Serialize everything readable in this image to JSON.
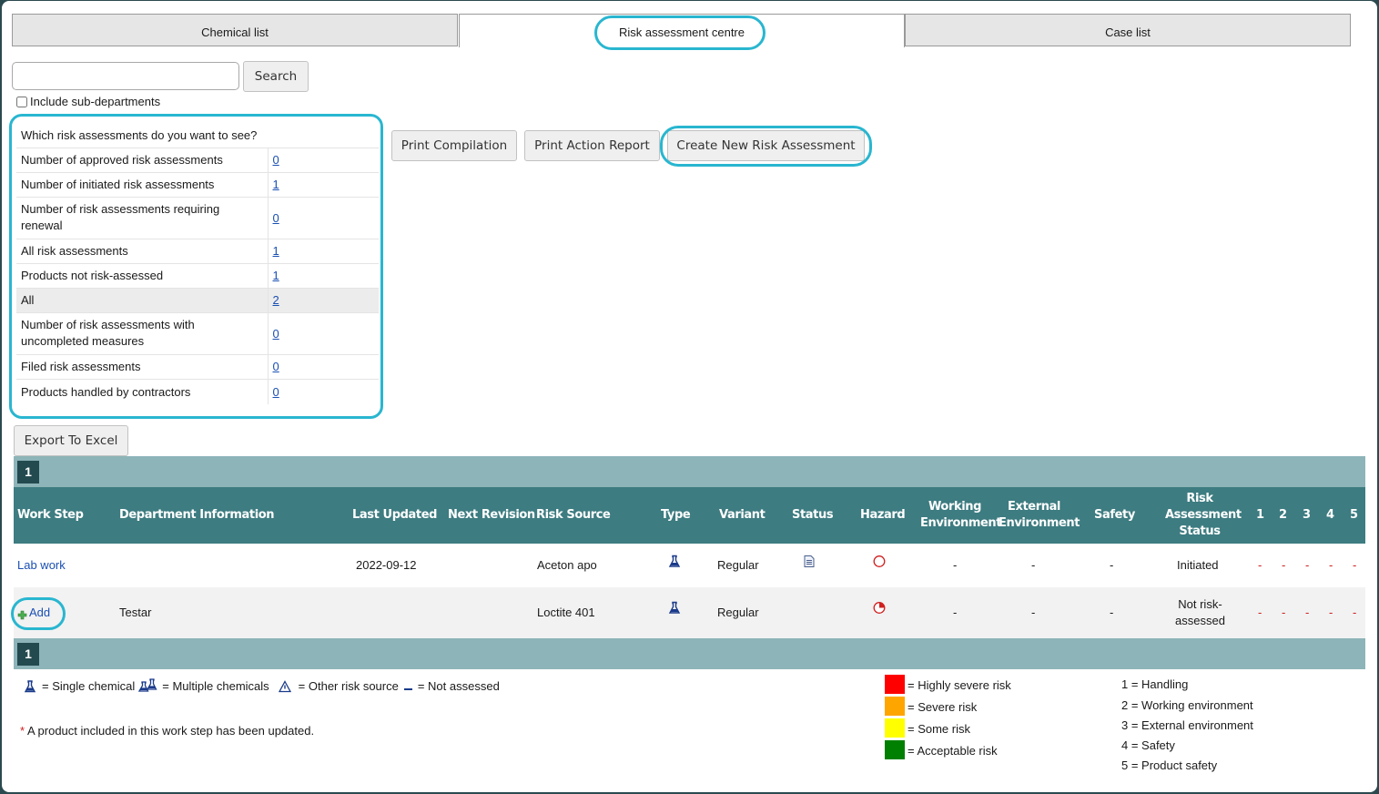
{
  "tabs": [
    {
      "label": "Chemical list",
      "active": false
    },
    {
      "label": "Risk assessment centre",
      "active": true
    },
    {
      "label": "Case list",
      "active": false
    }
  ],
  "search": {
    "value": "",
    "placeholder": "",
    "button_label": "Search"
  },
  "include_subdepartments_label": "Include sub-departments",
  "filter": {
    "question": "Which risk assessments do you want to see?",
    "rows": [
      {
        "label": "Number of approved risk assessments",
        "count": "0"
      },
      {
        "label": "Number of initiated risk assessments",
        "count": "1"
      },
      {
        "label": "Number of risk assessments requiring renewal",
        "count": "0"
      },
      {
        "label": "All risk assessments",
        "count": "1"
      },
      {
        "label": "Products not risk-assessed",
        "count": "1"
      },
      {
        "label": "All",
        "count": "2",
        "selected": true
      },
      {
        "label": "Number of risk assessments with uncompleted measures",
        "count": "0"
      },
      {
        "label": "Filed risk assessments",
        "count": "0"
      },
      {
        "label": "Products handled by contractors",
        "count": "0"
      }
    ]
  },
  "actions": {
    "print_compilation": "Print Compilation",
    "print_action_report": "Print Action Report",
    "create_new": "Create New Risk Assessment",
    "export_excel": "Export To Excel"
  },
  "pager": {
    "current_page": "1"
  },
  "columns": {
    "work_step": "Work Step",
    "department": "Department Information",
    "last_updated": "Last Updated",
    "next_revision": "Next Revision",
    "risk_source": "Risk Source",
    "type": "Type",
    "variant": "Variant",
    "status": "Status",
    "hazard": "Hazard",
    "working_env_1": "Working",
    "working_env_2": "Environment",
    "external_env_1": "External",
    "external_env_2": "Environment",
    "safety": "Safety",
    "ra_status_1": "Risk",
    "ra_status_2": "Assessment",
    "ra_status_3": "Status",
    "n1": "1",
    "n2": "2",
    "n3": "3",
    "n4": "4",
    "n5": "5"
  },
  "rows": [
    {
      "work_step": "Lab work",
      "department": "",
      "last_updated": "2022-09-12",
      "next_revision": "",
      "risk_source": "Aceton apo",
      "type_icon": "single-chemical-icon",
      "variant": "Regular",
      "status_icon": "document-icon",
      "hazard_icon": "hazard-circle-empty-icon",
      "working_environment": "-",
      "external_environment": "-",
      "safety": "-",
      "ra_status": "Initiated",
      "cat": [
        "-",
        "-",
        "-",
        "-",
        "-"
      ]
    },
    {
      "work_step": "Add",
      "department": "Testar",
      "last_updated": "",
      "next_revision": "",
      "risk_source": "Loctite 401",
      "type_icon": "single-chemical-icon",
      "variant": "Regular",
      "status_icon": "",
      "hazard_icon": "hazard-circle-partial-icon",
      "working_environment": "-",
      "external_environment": "-",
      "safety": "-",
      "ra_status_1": "Not risk-",
      "ra_status_2": "assessed",
      "cat": [
        "-",
        "-",
        "-",
        "-",
        "-"
      ]
    }
  ],
  "legend": {
    "single_chemical": "= Single chemical",
    "multiple_chemicals": "= Multiple chemicals",
    "other_risk_source": "= Other risk source",
    "not_assessed": "= Not assessed",
    "updated_note": "A product included in this work step has been updated.",
    "risk_levels": [
      {
        "label": "= Highly severe risk",
        "color": "#ff0000"
      },
      {
        "label": "= Severe risk",
        "color": "#ffa500"
      },
      {
        "label": "= Some risk",
        "color": "#ffff00"
      },
      {
        "label": "= Acceptable risk",
        "color": "#008000"
      }
    ],
    "categories": [
      "1 = Handling",
      "2 = Working environment",
      "3 = External environment",
      "4 = Safety",
      "5 = Product safety"
    ]
  }
}
